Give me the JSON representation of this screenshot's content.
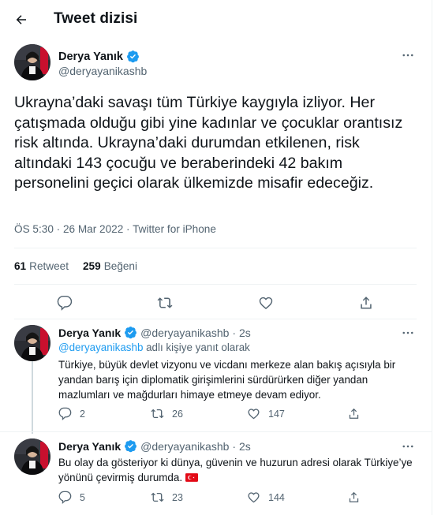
{
  "header": {
    "title": "Tweet dizisi"
  },
  "main_tweet": {
    "name": "Derya Yanık",
    "handle": "@deryayanikashb",
    "text": "Ukrayna’daki savaşı tüm Türkiye kaygıyla izliyor. Her çatışmada olduğu gibi yine kadınlar ve çocuklar orantısız risk altında. Ukrayna’daki durumdan etkilenen, risk altındaki 143 çocuğu ve beraberindeki 42 bakım personelini geçici olarak ülkemizde misafir edeceğiz.",
    "meta": "ÖS 5:30 · 26 Mar 2022 · Twitter for iPhone",
    "retweets_count": "61",
    "retweets_label": "Retweet",
    "likes_count": "259",
    "likes_label": "Beğeni"
  },
  "replies": [
    {
      "name": "Derya Yanık",
      "handle": "@deryayanikashb",
      "time": "· 2s",
      "replying_mention": "@deryayanikashb",
      "replying_suffix": " adlı kişiye yanıt olarak",
      "text": "Türkiye, büyük devlet vizyonu ve vicdanı merkeze alan bakış açısıyla bir yandan barış için diplomatik girişimlerini sürdürürken diğer yandan mazlumları ve mağdurları himaye etmeye devam ediyor.",
      "replies": "2",
      "retweets": "26",
      "likes": "147"
    },
    {
      "name": "Derya Yanık",
      "handle": "@deryayanikashb",
      "time": "· 2s",
      "text": "Bu olay da gösteriyor ki dünya, güvenin ve huzurun adresi olarak Türkiye’ye yönünü çevirmiş durumda.",
      "replies": "5",
      "retweets": "23",
      "likes": "144"
    }
  ],
  "icons": {
    "back": "arrow-left-icon",
    "verified": "verified-badge-icon",
    "more": "more-icon",
    "reply": "reply-icon",
    "retweet": "retweet-icon",
    "like": "heart-icon",
    "share": "share-icon",
    "flag": "turkey-flag-icon"
  },
  "colors": {
    "accent": "#1d9bf0",
    "text": "#0f1419",
    "muted": "#536471",
    "flag_red": "#e30a17"
  }
}
